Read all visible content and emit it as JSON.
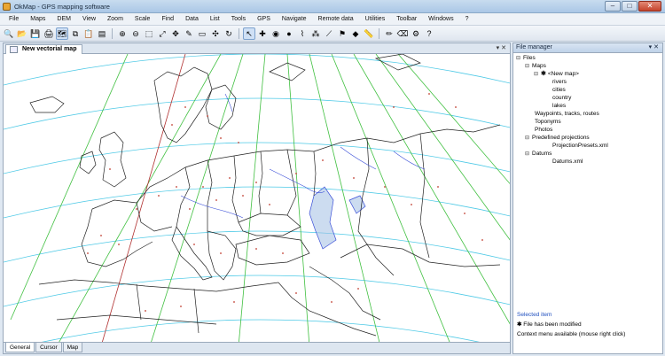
{
  "window": {
    "title": "OkMap - GPS mapping software",
    "minimize": "–",
    "maximize": "□",
    "close": "✕"
  },
  "menu": [
    "File",
    "Maps",
    "DEM",
    "View",
    "Zoom",
    "Scale",
    "Find",
    "Data",
    "List",
    "Tools",
    "GPS",
    "Navigate",
    "Remote data",
    "Utilities",
    "Toolbar",
    "Windows",
    "?"
  ],
  "toolbar": {
    "icons": [
      "binoculars-icon",
      "open-folder-icon",
      "save-icon",
      "print-icon",
      "map-icon",
      "copy-icon",
      "paste-icon",
      "layers-icon",
      "zoom-in-icon",
      "zoom-out-icon",
      "zoom-window-icon",
      "zoom-fit-icon",
      "pan-icon",
      "edit-icon",
      "select-icon",
      "move-icon",
      "rotate-icon",
      "cursor-icon",
      "crosshair-icon",
      "gps-icon",
      "waypoint-icon",
      "route-icon",
      "track-icon",
      "measure-icon",
      "flag-icon",
      "marker-icon",
      "ruler-icon",
      "pencil-icon",
      "eraser-icon",
      "settings-icon",
      "help-icon"
    ],
    "glyphs": [
      "🔍",
      "📂",
      "💾",
      "🖨",
      "🗺",
      "⧉",
      "📋",
      "▤",
      "⊕",
      "⊖",
      "⬚",
      "⤢",
      "✥",
      "✎",
      "▭",
      "✣",
      "↻",
      "↖",
      "✚",
      "◉",
      "●",
      "⌇",
      "⁂",
      "⟋",
      "⚑",
      "◆",
      "📏",
      "✏",
      "⌫",
      "⚙",
      "?"
    ]
  },
  "map_tab": {
    "label": "New vectorial map",
    "controls": "▾ ✕"
  },
  "bottom_tabs": [
    "General",
    "Cursor",
    "Map"
  ],
  "file_manager": {
    "title": "File manager",
    "controls": "▾ ✕",
    "tree": {
      "files": "Files",
      "maps": "Maps",
      "new_map": "<New map>",
      "layers": [
        "rivers",
        "cities",
        "country",
        "lakes"
      ],
      "waypoints": "Waypoints, tracks, routes",
      "toponyms": "Toponyms",
      "photos": "Photos",
      "predefined": "Predefined projections",
      "projection_file": "ProjectionPresets.xml",
      "datums": "Datums",
      "datums_file": "Datums.xml"
    },
    "footer": {
      "selected": "Selected item",
      "modified": "File has been modified",
      "context": "Context menu available (mouse right click)"
    }
  },
  "colors": {
    "graticule": "#41c041",
    "parallel": "#4dc9e6",
    "border": "#222222",
    "river": "#3a4fd8",
    "city": "#c0392b",
    "lake": "#aac4e6",
    "meridian_red": "#b03030"
  }
}
